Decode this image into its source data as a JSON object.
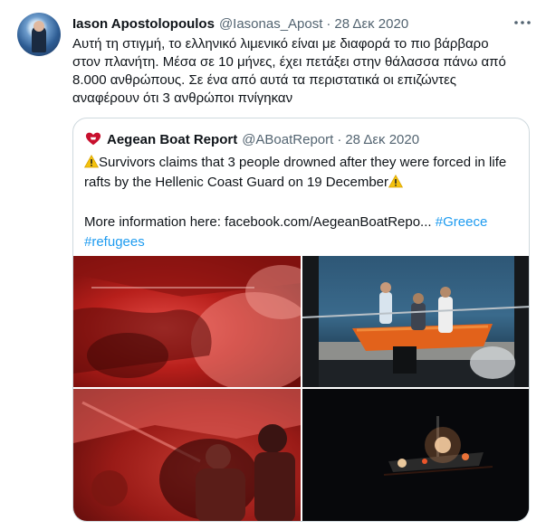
{
  "tweet": {
    "display_name": "Iason Apostolopoulos",
    "handle": "@Iasonas_Apost",
    "separator": "·",
    "date": "28 Δεκ 2020",
    "text_lines": [
      "Αυτή τη στιγμή, το ελληνικό λιμενικό είναι με διαφορά το πιο βάρβαρο",
      "στον πλανήτη. Μέσα σε 10 μήνες, έχει πετάξει στην θάλασσα πάνω από",
      "8.000 ανθρώπους. Σε ένα από αυτά τα περιστατικά οι επιζώντες",
      "αναφέρουν ότι 3 ανθρώποι πνίγηκαν"
    ],
    "more_icon": "more-horizontal-icon"
  },
  "quote": {
    "display_name": "Aegean Boat Report",
    "handle": "@ABoatReport",
    "separator": "·",
    "date": "28 Δεκ 2020",
    "avatar_icon": "heart-logo-icon",
    "line1": "Survivors claims that 3 people drowned after they were forced in life",
    "line2": "rafts by the Hellenic Coast Guard on 19 December",
    "more_info_label": "More information here:",
    "link": "facebook.com/AegeanBoatRepo...",
    "hashtag_greece": "#Greece",
    "hashtag_refugees": "#refugees",
    "warning_icon": "warning-icon"
  },
  "media": [
    {
      "name": "photo-raft-interior-red"
    },
    {
      "name": "photo-coast-guard-boat-deck"
    },
    {
      "name": "photo-people-in-raft"
    },
    {
      "name": "photo-boat-lights-at-night"
    }
  ],
  "colors": {
    "text": "#0f1419",
    "secondary": "#536471",
    "link": "#1d9bf0",
    "border": "#cfd9de",
    "warning": "#f4c20d",
    "logo": "#c8102e"
  }
}
